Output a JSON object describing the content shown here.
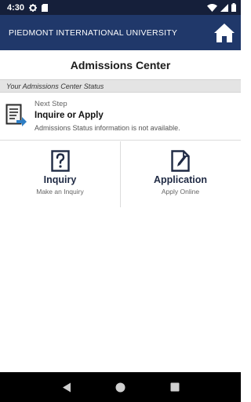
{
  "status_bar": {
    "time": "4:30"
  },
  "header": {
    "title": "PIEDMONT INTERNATIONAL UNIVERSITY"
  },
  "page": {
    "title": "Admissions Center"
  },
  "status_section": {
    "label": "Your Admissions Center Status"
  },
  "next_step": {
    "label": "Next Step",
    "title": "Inquire or Apply",
    "description": "Admissions Status information is not available."
  },
  "tiles": [
    {
      "title": "Inquiry",
      "subtitle": "Make an Inquiry",
      "icon": "question-document-icon"
    },
    {
      "title": "Application",
      "subtitle": "Apply Online",
      "icon": "pencil-document-icon"
    }
  ],
  "colors": {
    "status_bar": "#151f3a",
    "app_bar": "#20386a",
    "section_header": "#e4e4e4",
    "tile_icon": "#1f2a44"
  }
}
